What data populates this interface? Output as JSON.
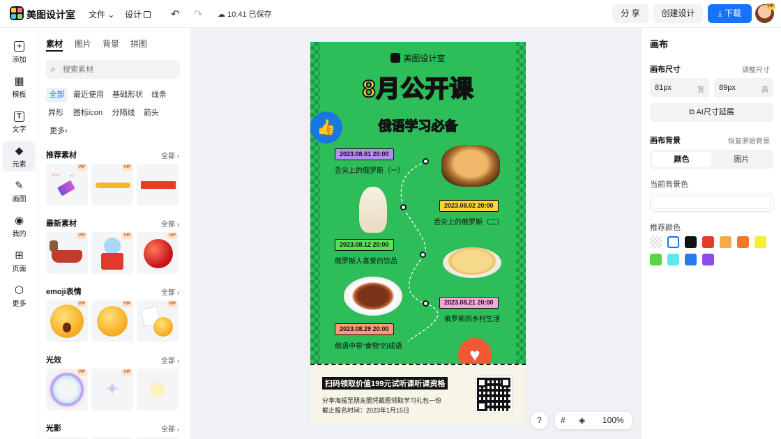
{
  "app": {
    "name": "美图设计室"
  },
  "menu": {
    "file": "文件",
    "design": "设计",
    "saved": "10:41 已保存"
  },
  "top_actions": {
    "share": "分 享",
    "create": "创建设计",
    "download": "下载",
    "vip": "VIP"
  },
  "rail": [
    {
      "icon": "add-icon",
      "label": "添加"
    },
    {
      "icon": "template-icon",
      "label": "模板"
    },
    {
      "icon": "text-icon",
      "label": "文字"
    },
    {
      "icon": "element-icon",
      "label": "元素"
    },
    {
      "icon": "draw-icon",
      "label": "画图"
    },
    {
      "icon": "user-icon",
      "label": "我的"
    },
    {
      "icon": "page-icon",
      "label": "页面"
    },
    {
      "icon": "more-icon",
      "label": "更多"
    }
  ],
  "left_panel": {
    "tabs": [
      "素材",
      "图片",
      "背景",
      "拼图"
    ],
    "search_placeholder": "搜索素材",
    "chips": [
      "全部",
      "最近使用",
      "基础形状",
      "线条",
      "异形",
      "图标icon",
      "分隔线",
      "箭头",
      "更多"
    ],
    "more_arrow": "›",
    "sections": [
      {
        "title": "推荐素材",
        "all": "全部"
      },
      {
        "title": "最新素材",
        "all": "全部"
      },
      {
        "title": "emoji表情",
        "all": "全部"
      },
      {
        "title": "光效",
        "all": "全部"
      },
      {
        "title": "光影",
        "all": "全部"
      }
    ],
    "vip_label": "VIP",
    "collapse": "‹"
  },
  "poster": {
    "brand": "美图设计室",
    "title": "8月公开课",
    "subtitle": "俄语学习必备",
    "events": [
      {
        "date": "2023.08.01 20:00",
        "caption": "舌尖上的俄罗斯（一）",
        "color": "#b48cf7"
      },
      {
        "date": "2023.08.02 20:00",
        "caption": "舌尖上的俄罗斯（二）",
        "color": "#ffd23a"
      },
      {
        "date": "2023.08.12 20:00",
        "caption": "俄罗斯人喜爱的饮品",
        "color": "#5be05a"
      },
      {
        "date": "2023.08.21 20:00",
        "caption": "俄罗斯的乡村生活",
        "color": "#f7a8d8"
      },
      {
        "date": "2023.08.29 20:00",
        "caption": "俄语中带“食物”的成语",
        "color": "#ff9a7a"
      }
    ],
    "bottom_title": "扫码领取价值199元试听课听课资格",
    "bottom_line1": "分享海报至朋友圈凭截图领取学习礼包一份",
    "bottom_line2": "截止报名时间：2023年1月15日"
  },
  "canvas_tools": {
    "help": "?",
    "zoom": "100%"
  },
  "right_panel": {
    "title": "画布",
    "size_label": "画布尺寸",
    "size_link": "调整尺寸",
    "width_value": "81px",
    "width_unit": "宽",
    "height_value": "89px",
    "height_unit": "高",
    "ai_button": "AI尺寸延展",
    "bg_label": "画布背景",
    "bg_reset": "恢复原始背景",
    "seg_color": "颜色",
    "seg_image": "图片",
    "current_bg_label": "当前背景色",
    "recommend_label": "推荐颜色",
    "swatches": [
      "transparent",
      "#ffffff",
      "#111111",
      "#e53a24",
      "#f5a84c",
      "#ef7a2a",
      "#f7ee3a",
      "#5cd24a",
      "#5ee8ec",
      "#2a7af0",
      "#8a4cf0"
    ]
  }
}
